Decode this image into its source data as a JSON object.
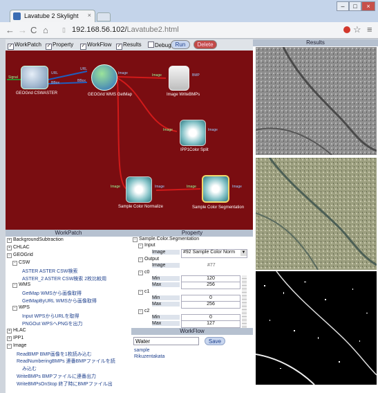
{
  "browser": {
    "tab_title": "Lavatube 2 Skylight",
    "tab_close": "×",
    "window_buttons": [
      "–",
      "□",
      "×"
    ],
    "url_host": "192.168.56.102/",
    "url_path": "Lavatube2.html",
    "nav_icons": [
      "arrow-left-icon",
      "arrow-right-icon",
      "reload-icon",
      "home-icon",
      "page-icon",
      "star-icon",
      "menu-icon"
    ]
  },
  "app": {
    "toggles": [
      {
        "label": "WorkPatch",
        "checked": true
      },
      {
        "label": "Property",
        "checked": true
      },
      {
        "label": "WorkFlow",
        "checked": true
      },
      {
        "label": "Results",
        "checked": true
      },
      {
        "label": "Debug",
        "checked": false
      }
    ],
    "run_label": "Run",
    "delete_label": "Delete",
    "results_title": "Results"
  },
  "canvas": {
    "nodes": [
      {
        "label": "GEOGrid CSWASTER",
        "ports_in": [
          "Signal"
        ],
        "ports_out": [
          "URL",
          "BBox"
        ]
      },
      {
        "label": "GEOGrid WMS GetMap",
        "ports_in": [
          "URL",
          "BBox"
        ],
        "ports_out": [
          "Image"
        ]
      },
      {
        "label": "Image WriteBMPs",
        "ports_in": [
          "Image"
        ],
        "ports_out": [
          "BMP"
        ]
      },
      {
        "label": "IPP1Color Split",
        "ports_in": [
          "Image"
        ],
        "ports_out": [
          "Image"
        ]
      },
      {
        "label": "Sample Color Normalize",
        "ports_in": [
          "Image"
        ],
        "ports_out": [
          "Image"
        ]
      },
      {
        "label": "Sample Color Segmentation",
        "ports_in": [
          "Image"
        ],
        "ports_out": [
          "Image"
        ]
      }
    ]
  },
  "workpatch": {
    "title": "WorkPatch",
    "items": [
      {
        "text": "BackgroundSubtraction",
        "sign": "+"
      },
      {
        "text": "CHLAC",
        "sign": "+"
      },
      {
        "text": "GEOGrid",
        "sign": "−"
      },
      {
        "text": "CSW",
        "sign": "−"
      },
      {
        "text": "ASTER ASTER CSW検索"
      },
      {
        "text": "ASTER_2 ASTER CSW検索 2枚比較用"
      },
      {
        "text": "WMS",
        "sign": "−"
      },
      {
        "text": "GetMap WMSから画像取得"
      },
      {
        "text": "GetMapByURL WMSから画像取得"
      },
      {
        "text": "WPS",
        "sign": "−"
      },
      {
        "text": "Input WPSからURLを取得"
      },
      {
        "text": "PNGOut WPSへPNGを出力"
      },
      {
        "text": "HLAC",
        "sign": "+"
      },
      {
        "text": "IPP1",
        "sign": "+"
      },
      {
        "text": "Image",
        "sign": "−"
      },
      {
        "text": "ReadBMP BMP画像を1枚読み込む"
      },
      {
        "text": "ReadNumberingBMPs 連番BMPファイルを読"
      },
      {
        "text": "み込む"
      },
      {
        "text": "WriteBMPs BMPファイルに連番出力"
      },
      {
        "text": "WriteBMPsOnStop 終了時にBMPファイル出"
      }
    ]
  },
  "property": {
    "title": "Property",
    "node_name": "Sample.Color.Segmentation",
    "input_label": "Input",
    "image_label": "Image",
    "image_select": "#92 Sample Color Norm",
    "output_label": "Output",
    "output_image_label": "Image",
    "output_image_value": "#77",
    "c0_label": "c0",
    "c1_label": "c1",
    "c2_label": "c2",
    "min_label": "Min",
    "max_label": "Max",
    "c0_min": "120",
    "c0_max": "256",
    "c1_min": "0",
    "c1_max": "256",
    "c2_min": "0",
    "c2_max": "127"
  },
  "workflow": {
    "title": "WorkFlow",
    "input_value": "Water",
    "save_label": "Save",
    "items": [
      "sample",
      "Rikuzentakata"
    ]
  }
}
